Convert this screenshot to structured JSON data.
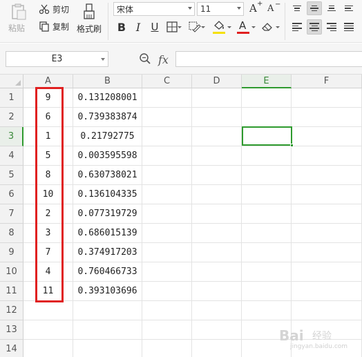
{
  "ribbon": {
    "paste_label": "粘贴",
    "cut_label": "剪切",
    "copy_label": "复制",
    "format_painter_label": "格式刷",
    "font_name": "宋体",
    "font_size": "11",
    "grow_font": "A",
    "shrink_font": "A",
    "bold": "B",
    "italic": "I",
    "underline": "U",
    "fill_color": "#f5e000",
    "font_color": "#e02020",
    "font_color_glyph": "A"
  },
  "formula_bar": {
    "name_box": "E3",
    "fx_label": "fx",
    "formula": ""
  },
  "grid": {
    "columns": [
      "A",
      "B",
      "C",
      "D",
      "E",
      "F"
    ],
    "rows": [
      "1",
      "2",
      "3",
      "4",
      "5",
      "6",
      "7",
      "8",
      "9",
      "10",
      "11",
      "12",
      "13",
      "14"
    ],
    "active_column": "E",
    "active_row": "3",
    "column_a": [
      "9",
      "6",
      "1",
      "5",
      "8",
      "10",
      "2",
      "3",
      "7",
      "4",
      "11"
    ],
    "column_b": [
      "0.131208001",
      "0.739383874",
      "0.21792775",
      "0.003595598",
      "0.630738021",
      "0.136104335",
      "0.077319729",
      "0.686015139",
      "0.374917203",
      "0.760466733",
      "0.393103696"
    ]
  },
  "colors": {
    "accent_green": "#2e9a2e",
    "highlight_red": "#e02020"
  },
  "watermark": {
    "brand": "Bai",
    "brand_sub": "经验",
    "url": "jingyan.baidu.com"
  }
}
